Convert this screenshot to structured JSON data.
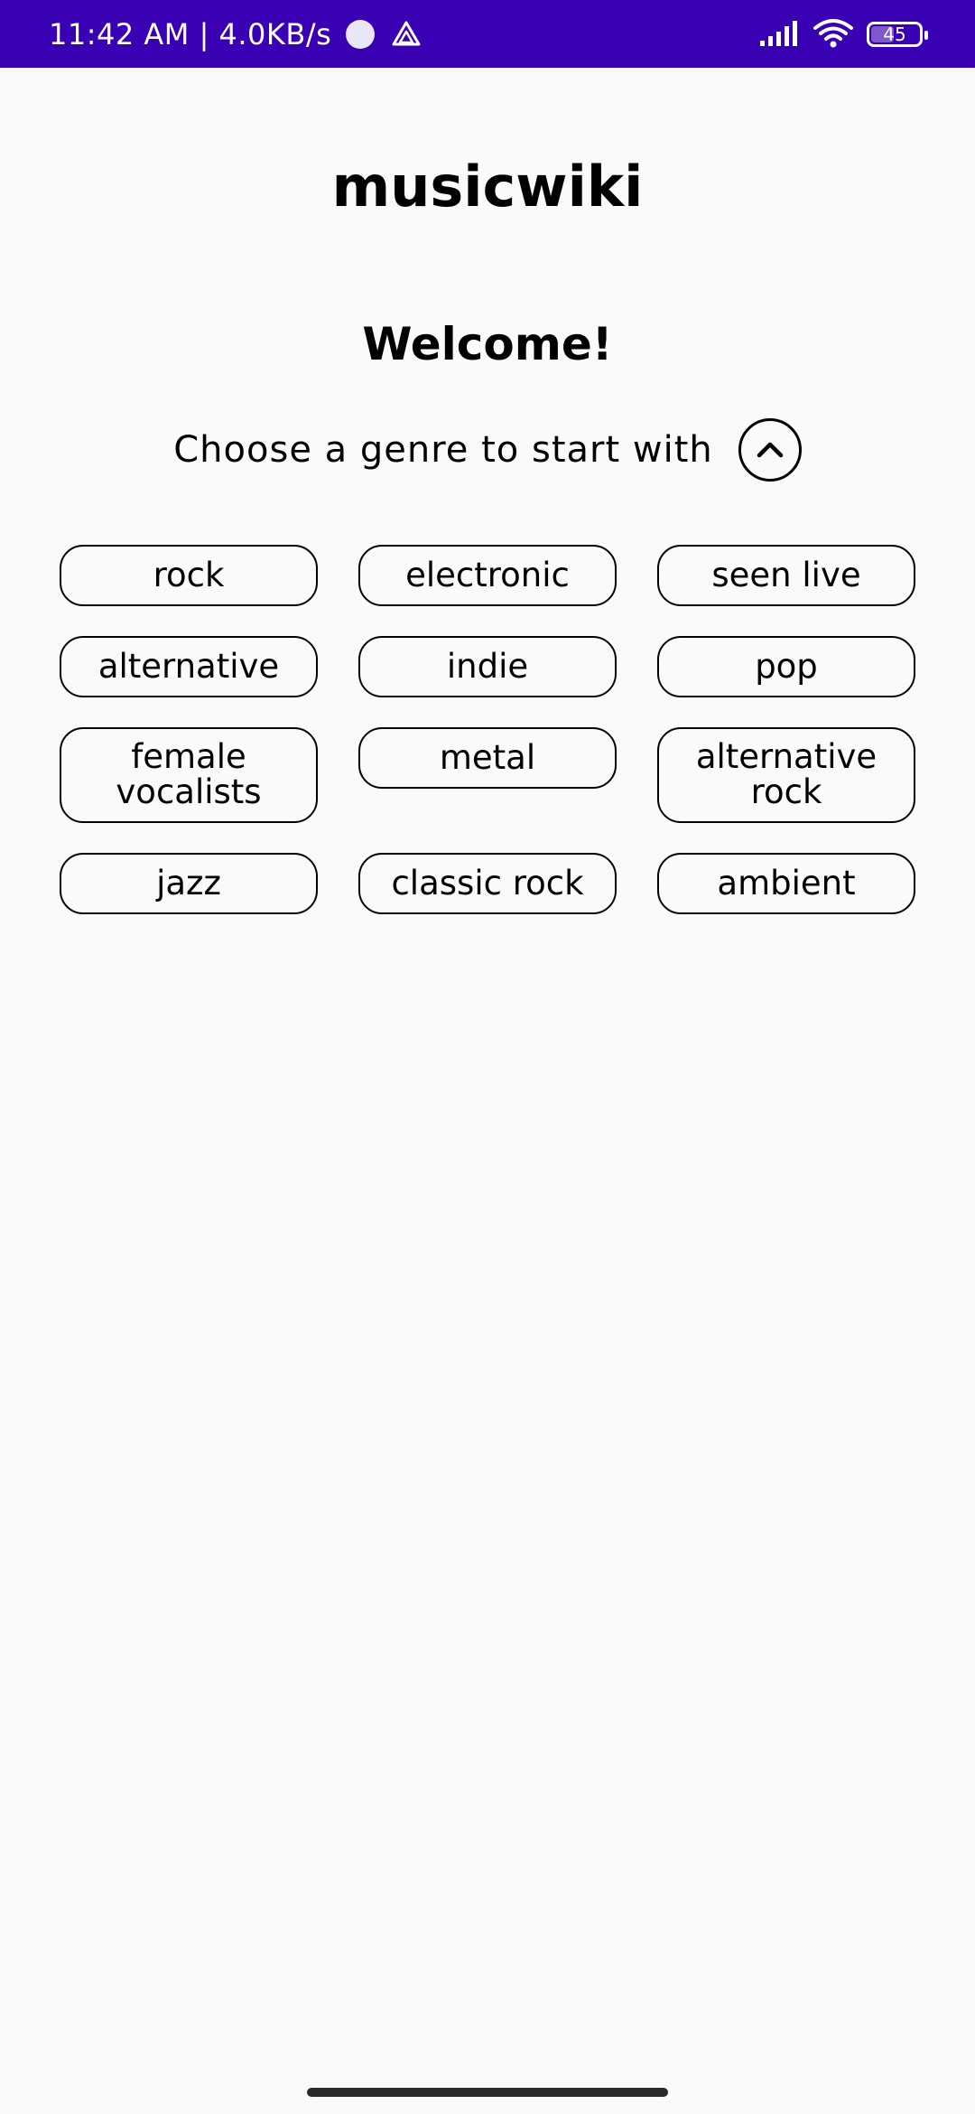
{
  "status_bar": {
    "time_speed": "11:42 AM | 4.0KB/s",
    "battery": "45",
    "bg_color": "#3a00b4",
    "icons": [
      "circle-notification-icon",
      "drive-icon",
      "signal-icon",
      "wifi-icon",
      "battery-icon"
    ]
  },
  "app": {
    "title": "musicwiki",
    "welcome": "Welcome!",
    "prompt": "Choose a genre to start with",
    "collapse_icon": "chevron-up-icon"
  },
  "genres": [
    {
      "label": "rock"
    },
    {
      "label": "electronic"
    },
    {
      "label": "seen live"
    },
    {
      "label": "alternative"
    },
    {
      "label": "indie"
    },
    {
      "label": "pop"
    },
    {
      "label": "female vocalists"
    },
    {
      "label": "metal"
    },
    {
      "label": "alternative rock"
    },
    {
      "label": "jazz"
    },
    {
      "label": "classic rock"
    },
    {
      "label": "ambient"
    }
  ]
}
